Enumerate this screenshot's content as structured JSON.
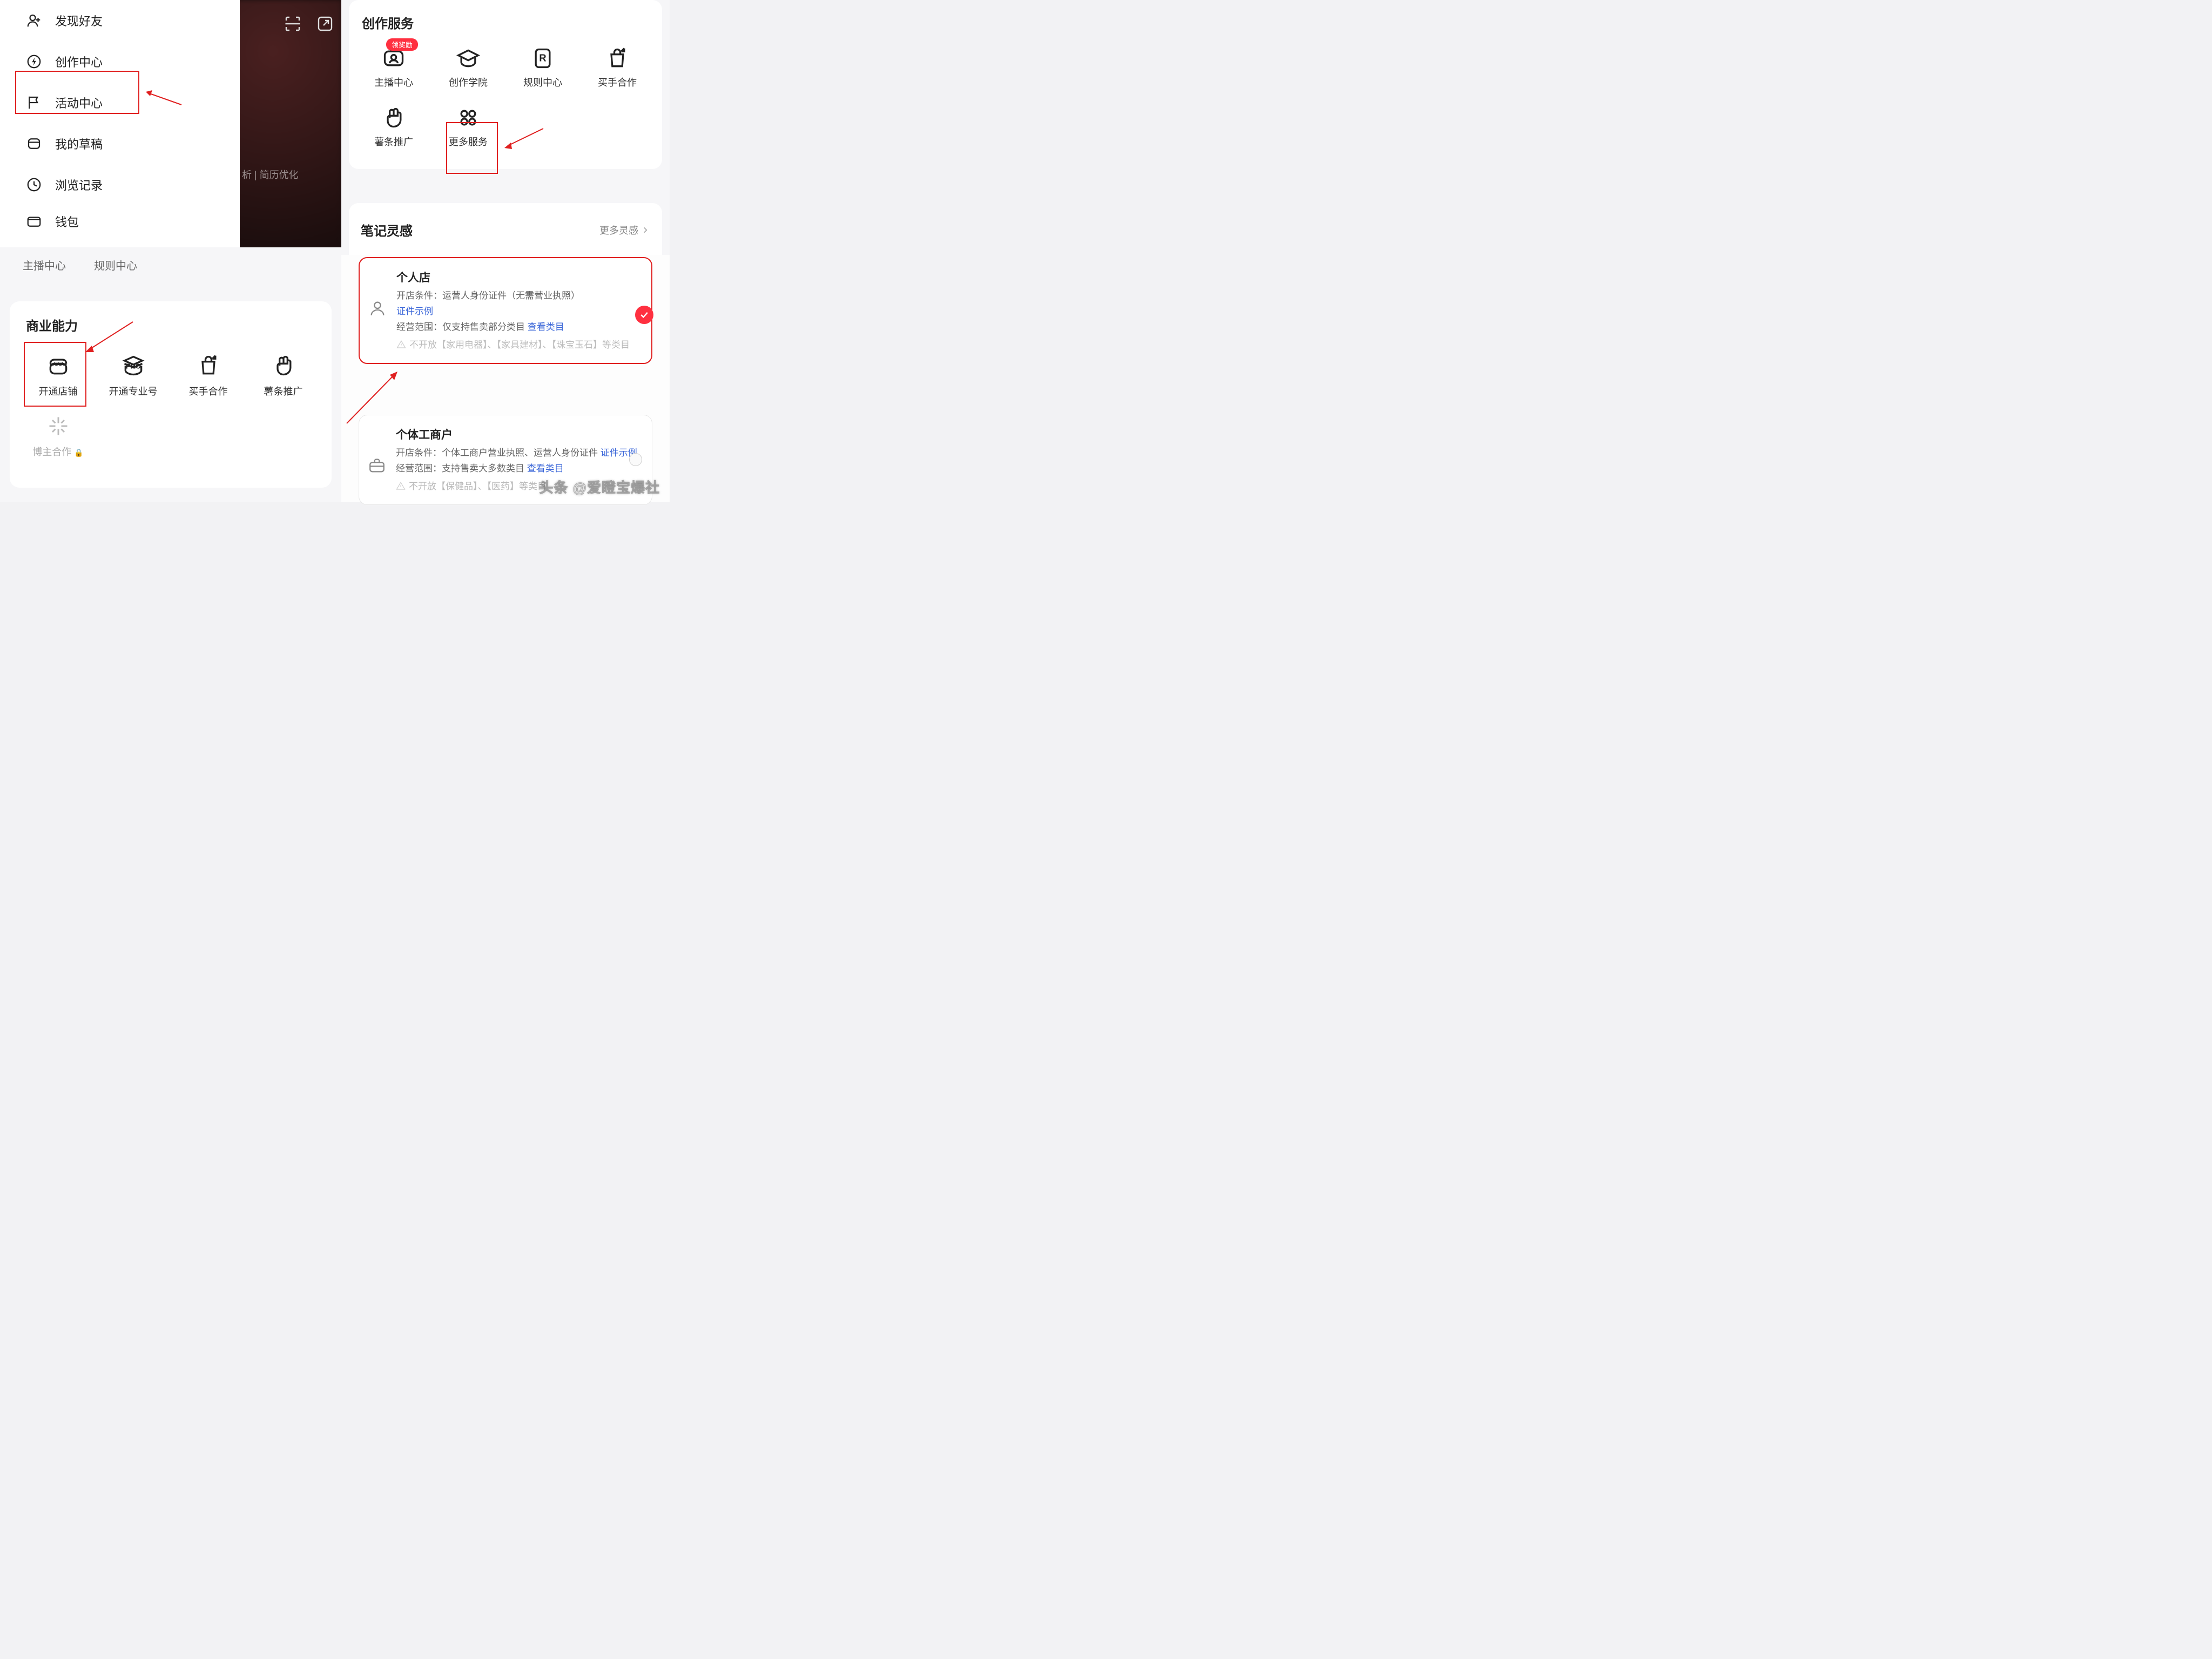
{
  "q1": {
    "menu": [
      {
        "label": "发现好友",
        "icon": "person-add-icon"
      },
      {
        "label": "创作中心",
        "icon": "bolt-icon"
      },
      {
        "label": "活动中心",
        "icon": "flag-icon"
      },
      {
        "label": "我的草稿",
        "icon": "draft-icon"
      },
      {
        "label": "浏览记录",
        "icon": "history-icon"
      },
      {
        "label": "钱包",
        "icon": "wallet-icon"
      }
    ],
    "dim_text": "析 | 简历优化"
  },
  "q3": {
    "chips": [
      "主播中心",
      "规则中心"
    ],
    "title": "商业能力",
    "cells": [
      {
        "label": "开通店铺",
        "icon": "storefront-icon"
      },
      {
        "label": "开通专业号",
        "icon": "pro-icon"
      },
      {
        "label": "买手合作",
        "icon": "bag-up-icon"
      },
      {
        "label": "薯条推广",
        "icon": "fist-icon"
      },
      {
        "label": "博主合作",
        "icon": "sparkle-icon",
        "locked": true
      }
    ]
  },
  "q2": {
    "title": "创作服务",
    "badge": "领奖励",
    "cells": [
      {
        "label": "主播中心",
        "icon": "broadcast-icon",
        "badge": true
      },
      {
        "label": "创作学院",
        "icon": "graduation-icon"
      },
      {
        "label": "规则中心",
        "icon": "rules-icon"
      },
      {
        "label": "买手合作",
        "icon": "bag-up-icon"
      },
      {
        "label": "薯条推广",
        "icon": "fist-icon"
      },
      {
        "label": "更多服务",
        "icon": "more-grid-icon"
      }
    ],
    "card2": {
      "title": "笔记灵感",
      "more": "更多灵感"
    }
  },
  "q4": {
    "card1": {
      "title": "个人店",
      "cond_label": "开店条件：",
      "cond_value": "运营人身份证件（无需营业执照）",
      "sample_link": "证件示例",
      "scope_label": "经营范围：",
      "scope_value": "仅支持售卖部分类目 ",
      "scope_link": "查看类目",
      "restricted": "不开放【家用电器】、【家具建材】、【珠宝玉石】等类目"
    },
    "card2": {
      "title": "个体工商户",
      "cond_label": "开店条件：",
      "cond_value": "个体工商户营业执照、运营人身份证件 ",
      "sample_link": "证件示例",
      "scope_label": "经营范围：",
      "scope_value": "支持售卖大多数类目 ",
      "scope_link": "查看类目",
      "restricted": "不开放【保健品】、【医药】等类目"
    }
  },
  "watermark": "头条 @爱瞪宝爆社"
}
